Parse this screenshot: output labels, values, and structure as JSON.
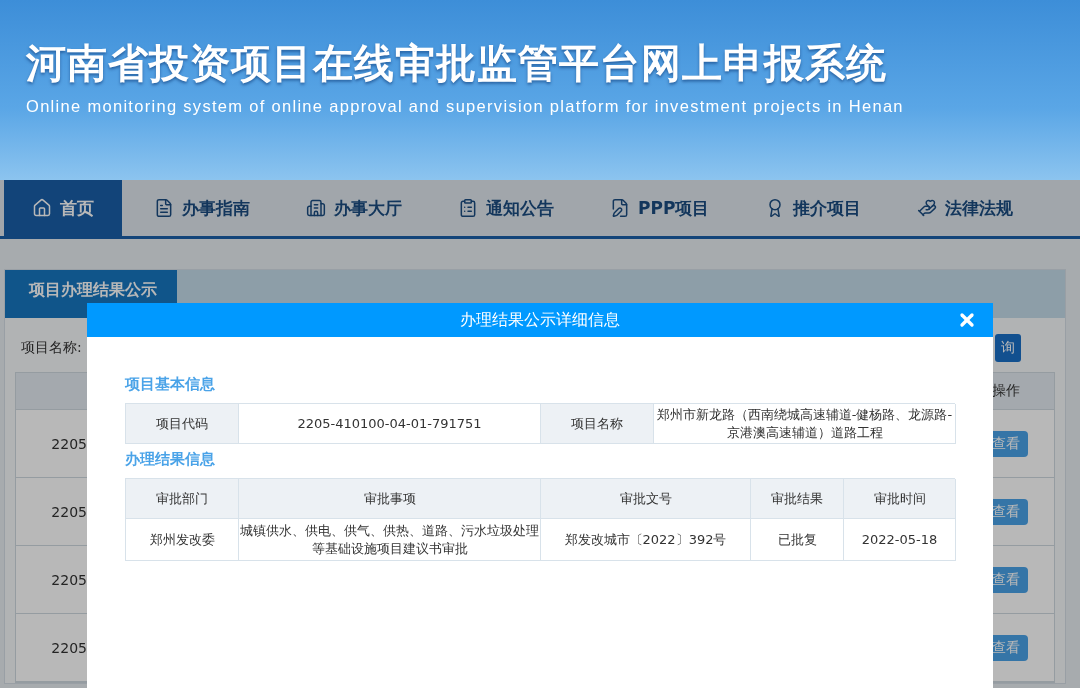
{
  "header": {
    "title": "河南省投资项目在线审批监管平台网上申报系统",
    "subtitle": "Online monitoring system of online approval and supervision platform for investment projects in Henan"
  },
  "nav": [
    {
      "label": "首页",
      "selected": true
    },
    {
      "label": "办事指南",
      "selected": false
    },
    {
      "label": "办事大厅",
      "selected": false
    },
    {
      "label": "通知公告",
      "selected": false
    },
    {
      "label": "PPP项目",
      "selected": false
    },
    {
      "label": "推介项目",
      "selected": false
    },
    {
      "label": "法律法规",
      "selected": false
    }
  ],
  "panel": {
    "tab": "项目办理结果公示",
    "search_label": "项目名称:",
    "search_button": "询",
    "table": {
      "last_column": "操作",
      "rows": [
        {
          "code": "2205",
          "action": "查看"
        },
        {
          "code": "2205",
          "action": "查看"
        },
        {
          "code": "2205",
          "action": "查看"
        },
        {
          "code": "2205",
          "action": "查看"
        }
      ]
    }
  },
  "modal": {
    "title": "办理结果公示详细信息",
    "sections": [
      {
        "heading": "项目基本信息",
        "kind": "fields",
        "fields": [
          {
            "label": "项目代码",
            "value": "2205-410100-04-01-791751"
          },
          {
            "label": "项目名称",
            "value": "郑州市新龙路（西南绕城高速辅道-健杨路、龙源路-京港澳高速辅道）道路工程"
          }
        ]
      },
      {
        "heading": "办理结果信息",
        "kind": "table",
        "columns": [
          "审批部门",
          "审批事项",
          "审批文号",
          "审批结果",
          "审批时间"
        ],
        "rows": [
          [
            "郑州发改委",
            "城镇供水、供电、供气、供热、道路、污水垃圾处理等基础设施项目建议书审批",
            "郑发改城市〔2022〕392号",
            "已批复",
            "2022-05-18"
          ]
        ]
      }
    ]
  }
}
